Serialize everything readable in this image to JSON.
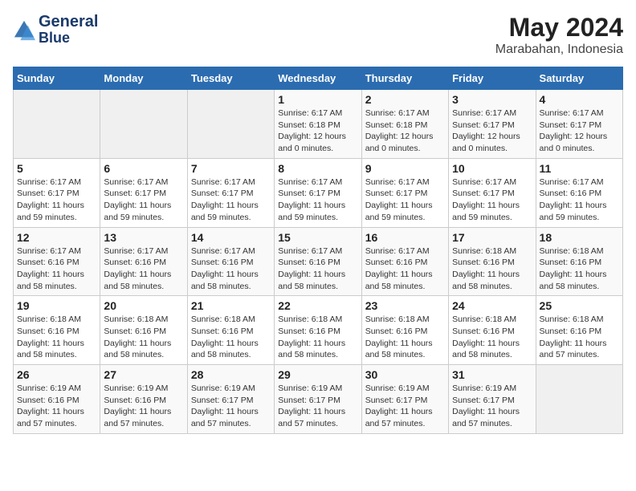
{
  "header": {
    "logo_line1": "General",
    "logo_line2": "Blue",
    "title": "May 2024",
    "subtitle": "Marabahan, Indonesia"
  },
  "weekdays": [
    "Sunday",
    "Monday",
    "Tuesday",
    "Wednesday",
    "Thursday",
    "Friday",
    "Saturday"
  ],
  "weeks": [
    [
      {
        "day": "",
        "sunrise": "",
        "sunset": "",
        "daylight": ""
      },
      {
        "day": "",
        "sunrise": "",
        "sunset": "",
        "daylight": ""
      },
      {
        "day": "",
        "sunrise": "",
        "sunset": "",
        "daylight": ""
      },
      {
        "day": "1",
        "sunrise": "Sunrise: 6:17 AM",
        "sunset": "Sunset: 6:18 PM",
        "daylight": "Daylight: 12 hours and 0 minutes."
      },
      {
        "day": "2",
        "sunrise": "Sunrise: 6:17 AM",
        "sunset": "Sunset: 6:18 PM",
        "daylight": "Daylight: 12 hours and 0 minutes."
      },
      {
        "day": "3",
        "sunrise": "Sunrise: 6:17 AM",
        "sunset": "Sunset: 6:17 PM",
        "daylight": "Daylight: 12 hours and 0 minutes."
      },
      {
        "day": "4",
        "sunrise": "Sunrise: 6:17 AM",
        "sunset": "Sunset: 6:17 PM",
        "daylight": "Daylight: 12 hours and 0 minutes."
      }
    ],
    [
      {
        "day": "5",
        "sunrise": "Sunrise: 6:17 AM",
        "sunset": "Sunset: 6:17 PM",
        "daylight": "Daylight: 11 hours and 59 minutes."
      },
      {
        "day": "6",
        "sunrise": "Sunrise: 6:17 AM",
        "sunset": "Sunset: 6:17 PM",
        "daylight": "Daylight: 11 hours and 59 minutes."
      },
      {
        "day": "7",
        "sunrise": "Sunrise: 6:17 AM",
        "sunset": "Sunset: 6:17 PM",
        "daylight": "Daylight: 11 hours and 59 minutes."
      },
      {
        "day": "8",
        "sunrise": "Sunrise: 6:17 AM",
        "sunset": "Sunset: 6:17 PM",
        "daylight": "Daylight: 11 hours and 59 minutes."
      },
      {
        "day": "9",
        "sunrise": "Sunrise: 6:17 AM",
        "sunset": "Sunset: 6:17 PM",
        "daylight": "Daylight: 11 hours and 59 minutes."
      },
      {
        "day": "10",
        "sunrise": "Sunrise: 6:17 AM",
        "sunset": "Sunset: 6:17 PM",
        "daylight": "Daylight: 11 hours and 59 minutes."
      },
      {
        "day": "11",
        "sunrise": "Sunrise: 6:17 AM",
        "sunset": "Sunset: 6:16 PM",
        "daylight": "Daylight: 11 hours and 59 minutes."
      }
    ],
    [
      {
        "day": "12",
        "sunrise": "Sunrise: 6:17 AM",
        "sunset": "Sunset: 6:16 PM",
        "daylight": "Daylight: 11 hours and 58 minutes."
      },
      {
        "day": "13",
        "sunrise": "Sunrise: 6:17 AM",
        "sunset": "Sunset: 6:16 PM",
        "daylight": "Daylight: 11 hours and 58 minutes."
      },
      {
        "day": "14",
        "sunrise": "Sunrise: 6:17 AM",
        "sunset": "Sunset: 6:16 PM",
        "daylight": "Daylight: 11 hours and 58 minutes."
      },
      {
        "day": "15",
        "sunrise": "Sunrise: 6:17 AM",
        "sunset": "Sunset: 6:16 PM",
        "daylight": "Daylight: 11 hours and 58 minutes."
      },
      {
        "day": "16",
        "sunrise": "Sunrise: 6:17 AM",
        "sunset": "Sunset: 6:16 PM",
        "daylight": "Daylight: 11 hours and 58 minutes."
      },
      {
        "day": "17",
        "sunrise": "Sunrise: 6:18 AM",
        "sunset": "Sunset: 6:16 PM",
        "daylight": "Daylight: 11 hours and 58 minutes."
      },
      {
        "day": "18",
        "sunrise": "Sunrise: 6:18 AM",
        "sunset": "Sunset: 6:16 PM",
        "daylight": "Daylight: 11 hours and 58 minutes."
      }
    ],
    [
      {
        "day": "19",
        "sunrise": "Sunrise: 6:18 AM",
        "sunset": "Sunset: 6:16 PM",
        "daylight": "Daylight: 11 hours and 58 minutes."
      },
      {
        "day": "20",
        "sunrise": "Sunrise: 6:18 AM",
        "sunset": "Sunset: 6:16 PM",
        "daylight": "Daylight: 11 hours and 58 minutes."
      },
      {
        "day": "21",
        "sunrise": "Sunrise: 6:18 AM",
        "sunset": "Sunset: 6:16 PM",
        "daylight": "Daylight: 11 hours and 58 minutes."
      },
      {
        "day": "22",
        "sunrise": "Sunrise: 6:18 AM",
        "sunset": "Sunset: 6:16 PM",
        "daylight": "Daylight: 11 hours and 58 minutes."
      },
      {
        "day": "23",
        "sunrise": "Sunrise: 6:18 AM",
        "sunset": "Sunset: 6:16 PM",
        "daylight": "Daylight: 11 hours and 58 minutes."
      },
      {
        "day": "24",
        "sunrise": "Sunrise: 6:18 AM",
        "sunset": "Sunset: 6:16 PM",
        "daylight": "Daylight: 11 hours and 58 minutes."
      },
      {
        "day": "25",
        "sunrise": "Sunrise: 6:18 AM",
        "sunset": "Sunset: 6:16 PM",
        "daylight": "Daylight: 11 hours and 57 minutes."
      }
    ],
    [
      {
        "day": "26",
        "sunrise": "Sunrise: 6:19 AM",
        "sunset": "Sunset: 6:16 PM",
        "daylight": "Daylight: 11 hours and 57 minutes."
      },
      {
        "day": "27",
        "sunrise": "Sunrise: 6:19 AM",
        "sunset": "Sunset: 6:16 PM",
        "daylight": "Daylight: 11 hours and 57 minutes."
      },
      {
        "day": "28",
        "sunrise": "Sunrise: 6:19 AM",
        "sunset": "Sunset: 6:17 PM",
        "daylight": "Daylight: 11 hours and 57 minutes."
      },
      {
        "day": "29",
        "sunrise": "Sunrise: 6:19 AM",
        "sunset": "Sunset: 6:17 PM",
        "daylight": "Daylight: 11 hours and 57 minutes."
      },
      {
        "day": "30",
        "sunrise": "Sunrise: 6:19 AM",
        "sunset": "Sunset: 6:17 PM",
        "daylight": "Daylight: 11 hours and 57 minutes."
      },
      {
        "day": "31",
        "sunrise": "Sunrise: 6:19 AM",
        "sunset": "Sunset: 6:17 PM",
        "daylight": "Daylight: 11 hours and 57 minutes."
      },
      {
        "day": "",
        "sunrise": "",
        "sunset": "",
        "daylight": ""
      }
    ]
  ]
}
